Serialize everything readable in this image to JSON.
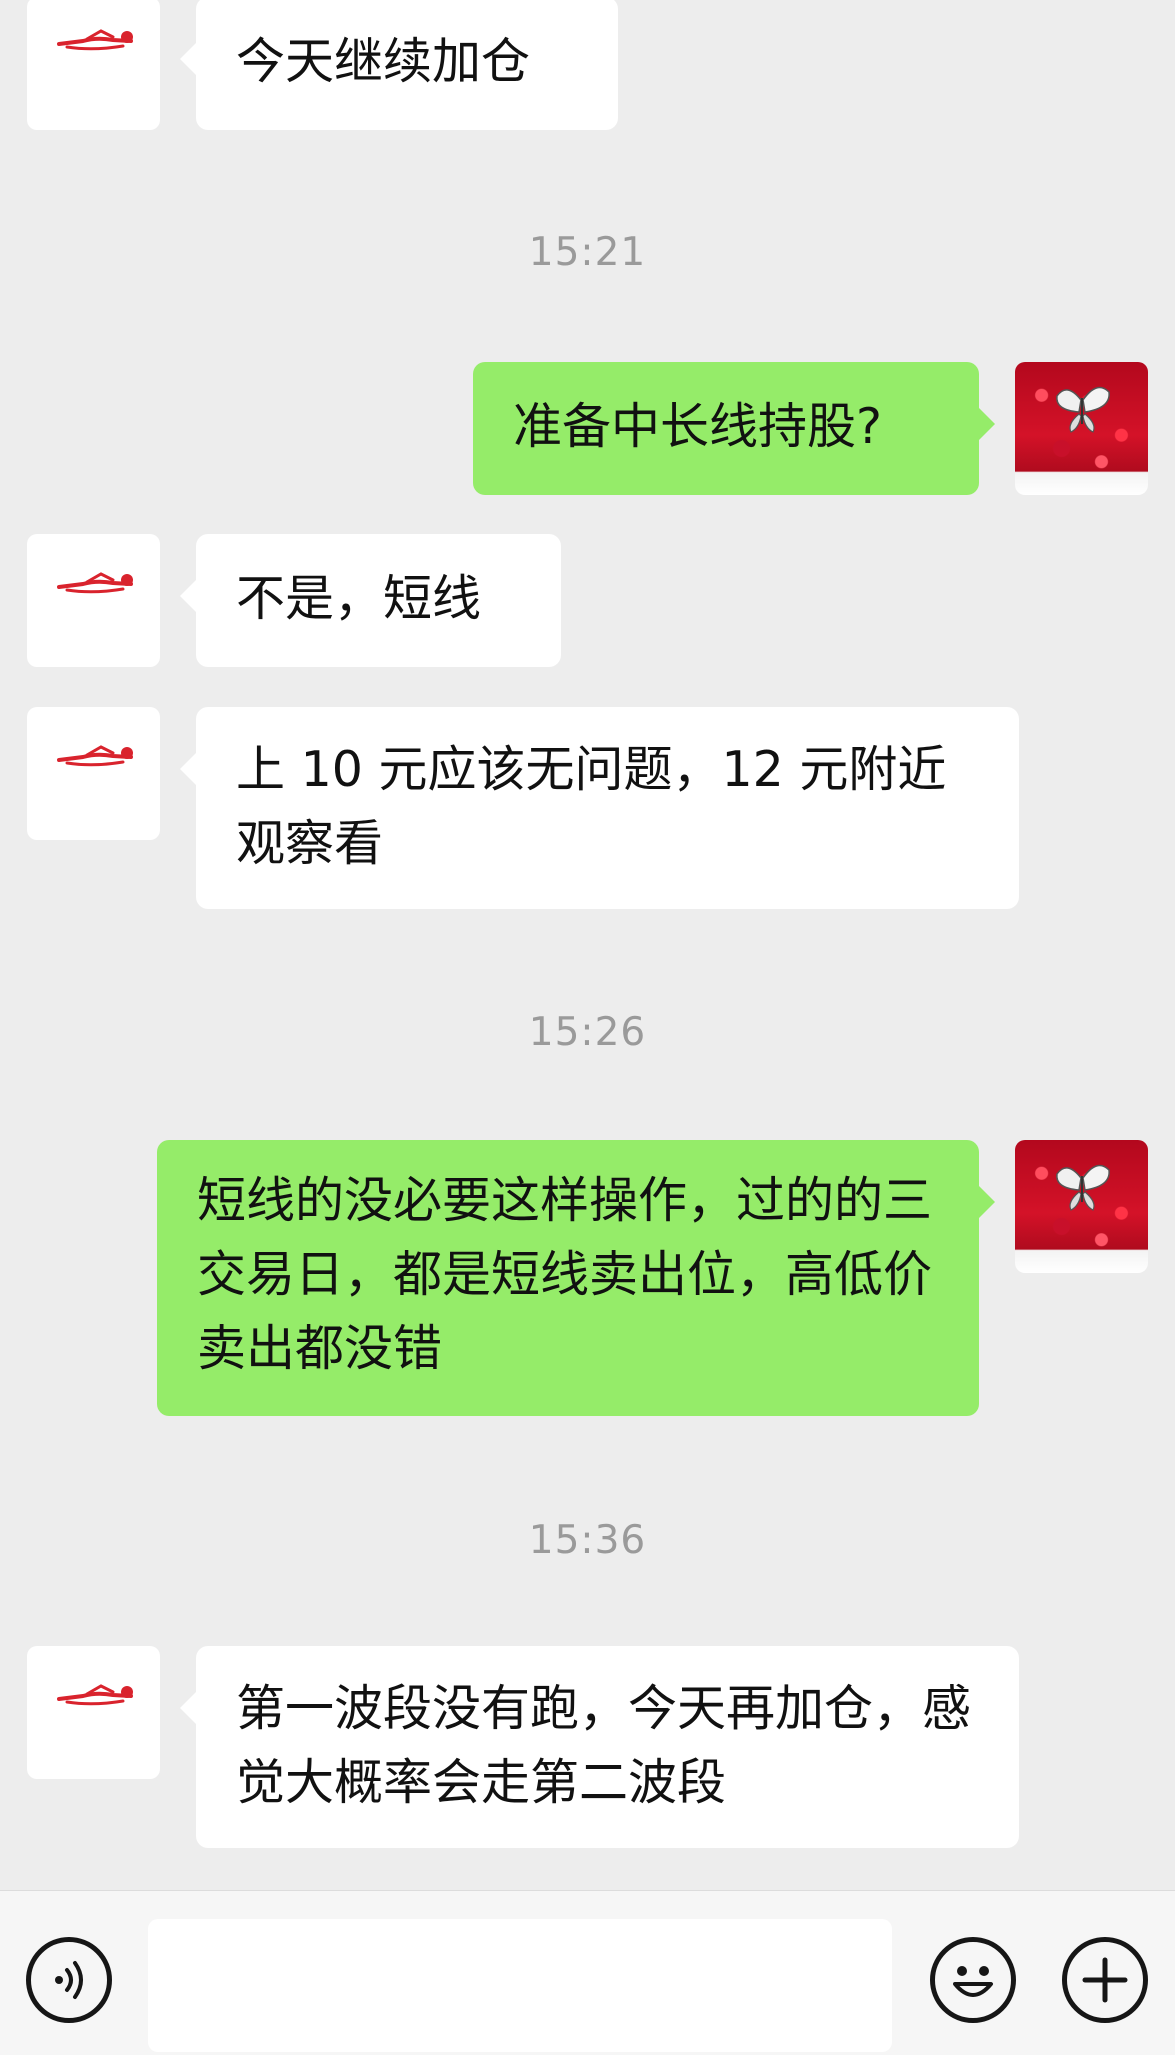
{
  "messages": [
    {
      "side": "left",
      "text": "今天继续加仓"
    },
    {
      "side": "right",
      "text": "准备中长线持股?"
    },
    {
      "side": "left",
      "text": "不是，短线"
    },
    {
      "side": "left",
      "text": "上 10 元应该无问题，12 元附近观察看"
    },
    {
      "side": "right",
      "text": "短线的没必要这样操作，过的的三交易日，都是短线卖出位，高低价卖出都没错"
    },
    {
      "side": "left",
      "text": "第一波段没有跑，今天再加仓，感觉大概率会走第二波段"
    }
  ],
  "timestamps": [
    "15:21",
    "15:26",
    "15:36"
  ],
  "input_bar": {
    "value": "",
    "voice_icon": "voice-icon",
    "emoji_icon": "emoji-icon",
    "plus_icon": "plus-icon"
  },
  "colors": {
    "background": "#ededed",
    "incoming_bubble": "#ffffff",
    "outgoing_bubble": "#95ec69",
    "timestamp_text": "#9a9a9a"
  }
}
